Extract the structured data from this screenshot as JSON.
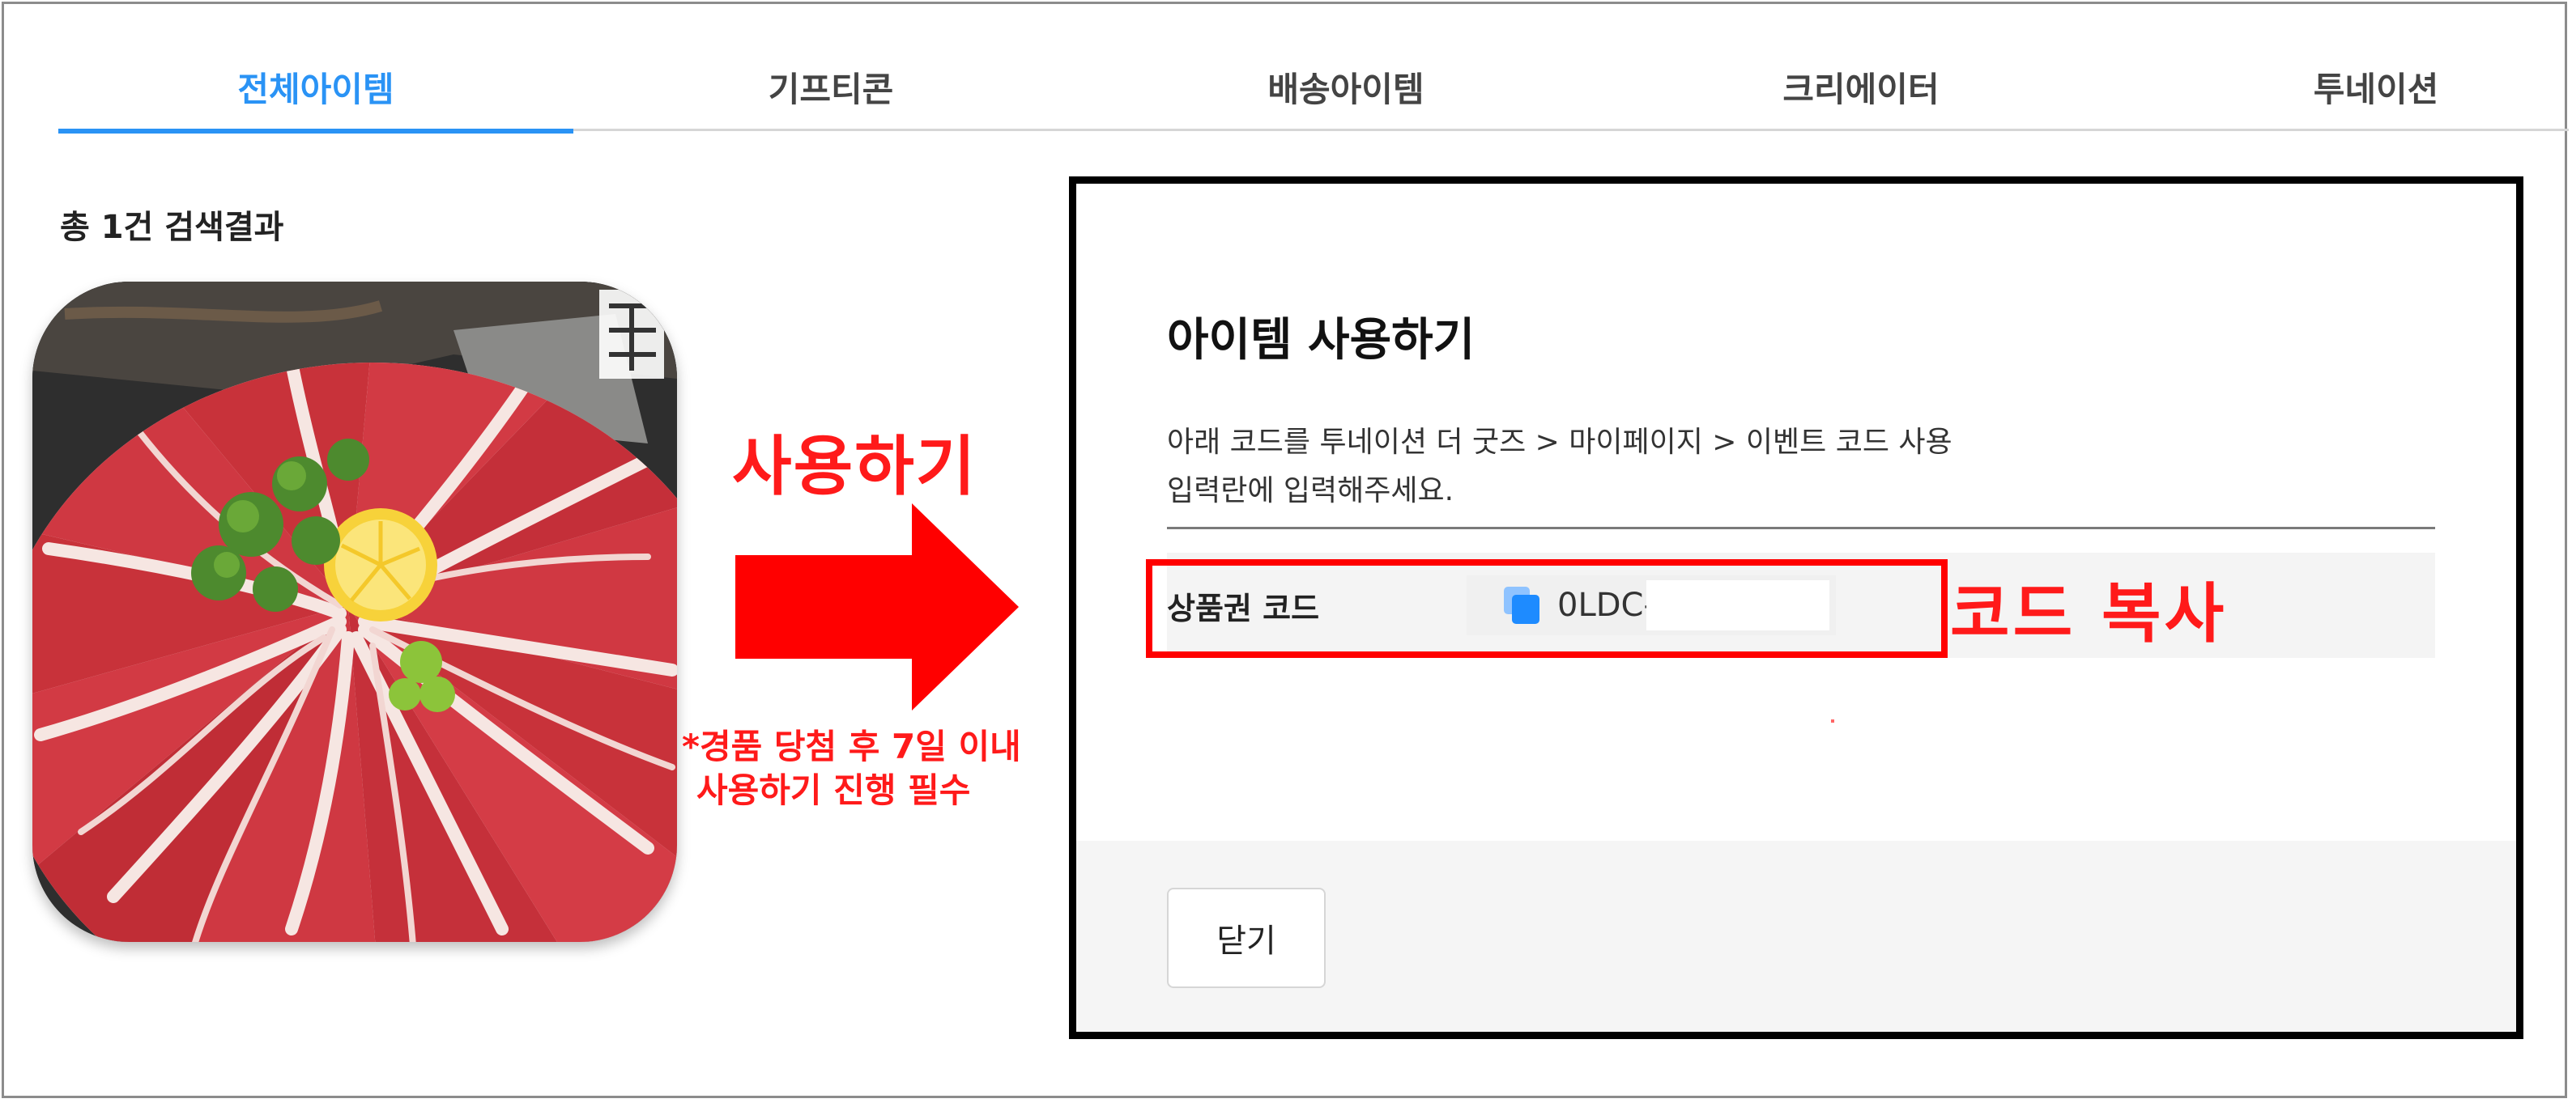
{
  "tabs": [
    {
      "label": "전체아이템",
      "active": true
    },
    {
      "label": "기프티콘",
      "active": false
    },
    {
      "label": "배송아이템",
      "active": false
    },
    {
      "label": "크리에이터",
      "active": false
    },
    {
      "label": "투네이션",
      "active": false
    }
  ],
  "results": {
    "count_text": "총 1건 검색결과"
  },
  "annotations": {
    "use_label": "사용하기",
    "note_line1": "*경품 당첨 후 7일 이내",
    "note_line2": "사용하기 진행 필수",
    "copy_label": "코드 복사"
  },
  "modal": {
    "title": "아이템 사용하기",
    "desc_line1": "아래 코드를 투네이션 더 굿즈 > 마이페이지 > 이벤트 코드 사용",
    "desc_line2": "입력란에 입력해주세요.",
    "code_label": "상품권 코드",
    "code_value": "0LDC-",
    "close_label": "닫기"
  },
  "colors": {
    "accent": "#2a93f5",
    "annotation": "#ff1a1a",
    "modal_border": "#000000"
  }
}
